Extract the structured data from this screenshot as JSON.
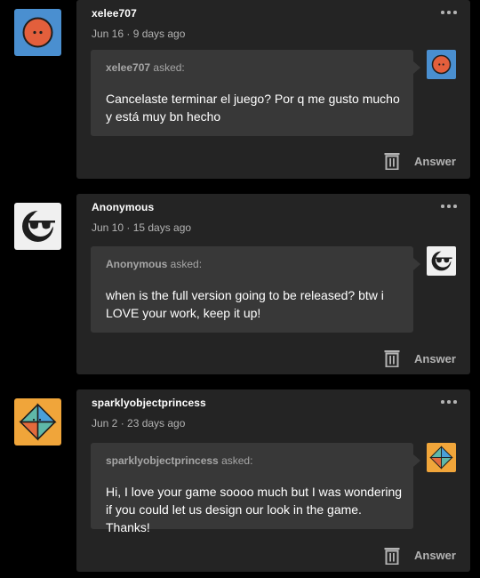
{
  "posts": [
    {
      "username": "xelee707",
      "date": "Jun 16 · 9 days ago",
      "asker": "xelee707",
      "asked_label": " asked:",
      "question": "Cancelaste terminar el juego? Por q me gusto mucho y está muy bn hecho",
      "answer_label": "Answer",
      "avatar_icon": "orange-face-avatar-icon",
      "avatar_bg": "#4a8fd0"
    },
    {
      "username": "Anonymous",
      "date": "Jun 10 · 15 days ago",
      "asker": "Anonymous",
      "asked_label": " asked:",
      "question": "when is the full version going to be released? btw i LOVE your work, keep it up!",
      "answer_label": "Answer",
      "avatar_icon": "sunglasses-ghost-avatar-icon",
      "avatar_bg": "#f0f0f0"
    },
    {
      "username": "sparklyobjectprincess",
      "date": "Jun 2 · 23 days ago",
      "asker": "sparklyobjectprincess",
      "asked_label": " asked:",
      "question": "Hi, I love your game soooo much but I was wondering if you could let us design our look in the game. Thanks!",
      "answer_label": "Answer",
      "avatar_icon": "diamond-gem-avatar-icon",
      "avatar_bg": "#f0a53a"
    }
  ],
  "colors": {
    "page_bg": "#000000",
    "card_bg": "#242424",
    "bubble_bg": "#383838",
    "muted_text": "#b3b3b3"
  }
}
